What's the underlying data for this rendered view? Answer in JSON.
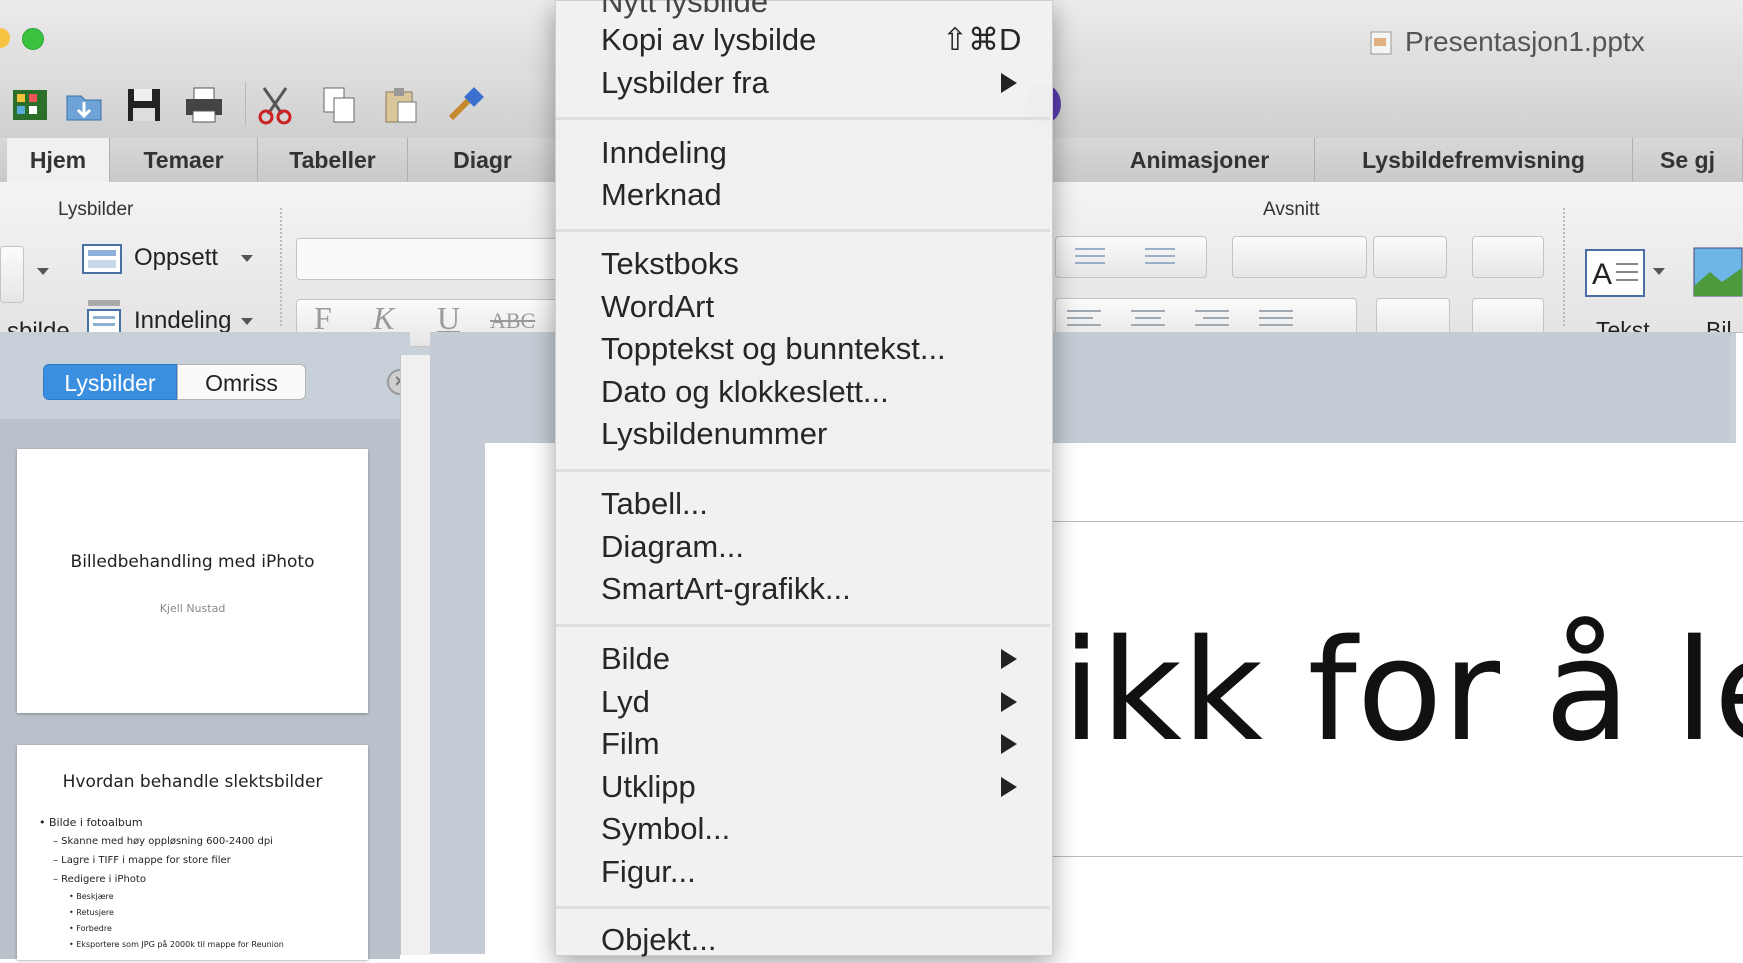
{
  "window": {
    "document_title": "Presentasjon1.pptx"
  },
  "ribbon_tabs": [
    "Hjem",
    "Temaer",
    "Tabeller",
    "Diagr",
    "Animasjoner",
    "Lysbildefremvisning",
    "Se gj"
  ],
  "ribbon": {
    "group_slides": "Lysbilder",
    "group_paragraph": "Avsnitt",
    "layout_label": "Oppsett",
    "section_label": "Inndeling",
    "new_slide_partial": "sbilde",
    "text_label": "Tekst",
    "picture_partial": "Bil",
    "format_buttons": [
      "F",
      "K",
      "U",
      "ABC"
    ]
  },
  "left_panel": {
    "tabs": [
      "Lysbilder",
      "Omriss"
    ],
    "slides": [
      {
        "title": "Billedbehandling med iPhoto",
        "subtitle": "Kjell Nustad"
      },
      {
        "title": "Hvordan behandle slektsbilder",
        "bullets": [
          "• Bilde i fotoalbum",
          "– Skanne med høy oppløsning 600-2400 dpi",
          "– Lagre i TIFF i mappe for store filer",
          "– Redigere i iPhoto",
          "• Beskjære",
          "• Retusjere",
          "• Forbedre",
          "• Eksportere som JPG på 2000k til mappe for Reunion"
        ]
      }
    ]
  },
  "slide_main": {
    "title_text": "ikk for å le"
  },
  "menu": {
    "top_partial": "Nytt lysbilde",
    "items": {
      "duplicate": "Kopi av lysbilde",
      "duplicate_shortcut": "⇧⌘D",
      "slides_from": "Lysbilder fra",
      "section": "Inndeling",
      "comment": "Merknad",
      "textbox": "Tekstboks",
      "wordart": "WordArt",
      "header_footer": "Topptekst og bunntekst...",
      "date_time": "Dato og klokkeslett...",
      "slide_number": "Lysbildenummer",
      "table": "Tabell...",
      "chart": "Diagram...",
      "smartart": "SmartArt-grafikk...",
      "picture": "Bilde",
      "audio": "Lyd",
      "movie": "Film",
      "clip": "Utklipp",
      "symbol": "Symbol...",
      "shape": "Figur...",
      "object": "Objekt..."
    }
  },
  "colors": {
    "accent_blue": "#3b8fe0",
    "menu_bg": "#f1f1f1",
    "green_light": "#3ac240"
  }
}
